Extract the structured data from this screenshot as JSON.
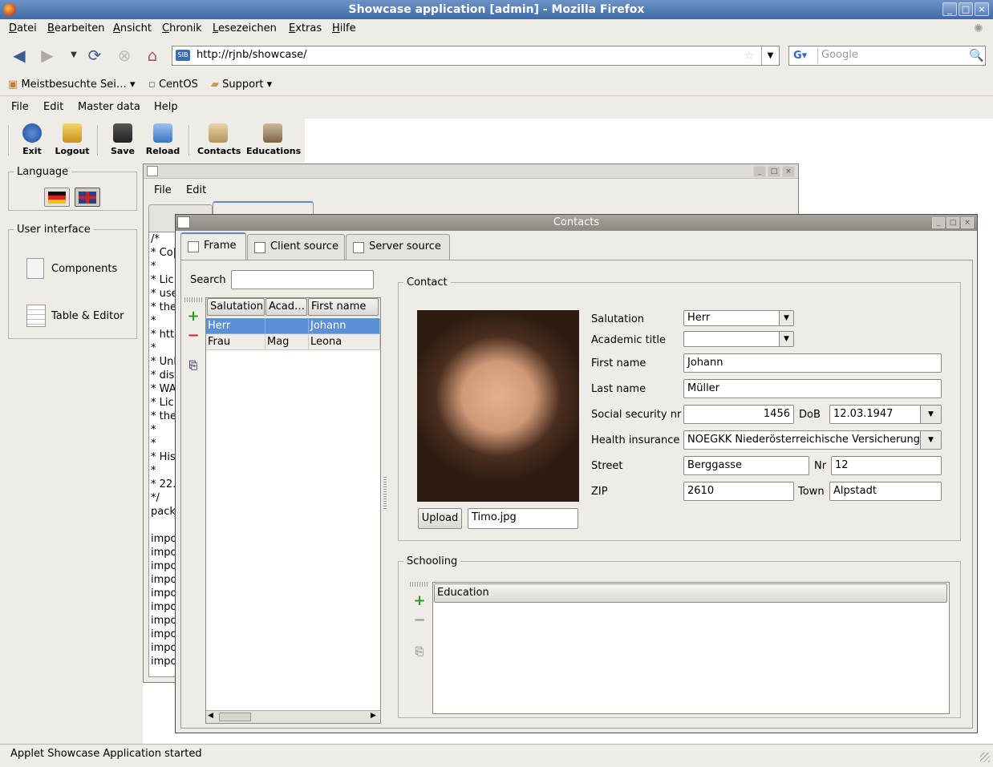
{
  "window": {
    "title": "Showcase application [admin] - Mozilla Firefox"
  },
  "browser_menu": [
    "Datei",
    "Bearbeiten",
    "Ansicht",
    "Chronik",
    "Lesezeichen",
    "Extras",
    "Hilfe"
  ],
  "nav": {
    "url": "http://rjnb/showcase/",
    "search_placeholder": "Google"
  },
  "bookmarks": [
    "Meistbesuchte Sei…",
    "CentOS",
    "Support"
  ],
  "app_menu": [
    "File",
    "Edit",
    "Master data",
    "Help"
  ],
  "toolbar": {
    "exit": "Exit",
    "logout": "Logout",
    "save": "Save",
    "reload": "Reload",
    "contacts": "Contacts",
    "educations": "Educations"
  },
  "left_panel": {
    "language_title": "Language",
    "ui_title": "User interface",
    "components": "Components",
    "table_editor": "Table & Editor"
  },
  "bg_frame": {
    "menu": [
      "File",
      "Edit"
    ],
    "code_lines": [
      "/*",
      "* Co|",
      "*",
      "* Lic",
      "* use",
      "* the",
      "*",
      "* http",
      "*",
      "* Unl",
      "* dist",
      "* WA",
      "* Lic",
      "* the",
      "*",
      "*",
      "* His",
      "*",
      "* 22.",
      "*/",
      "packa",
      "",
      "impo",
      "impo",
      "impo",
      "impo",
      "impo",
      "impo",
      "impo",
      "impo",
      "impo",
      "impo"
    ]
  },
  "contacts": {
    "title": "Contacts",
    "tabs": [
      "Frame",
      "Client source",
      "Server source"
    ],
    "search_label": "Search",
    "search_value": "",
    "table_headers": [
      "Salutation",
      "Acad…",
      "First name"
    ],
    "rows": [
      [
        "Herr",
        "",
        "Johann"
      ],
      [
        "Frau",
        "Mag",
        "Leona"
      ]
    ],
    "contact_group": "Contact",
    "upload_button": "Upload",
    "photo_file": "Timo.jpg",
    "fields": {
      "salutation_label": "Salutation",
      "salutation": "Herr",
      "academic_label": "Academic title",
      "academic": "",
      "first_name_label": "First name",
      "first_name": "Johann",
      "last_name_label": "Last name",
      "last_name": "Müller",
      "ssn_label": "Social security nr",
      "ssn": "1456",
      "dob_label": "DoB",
      "dob": "12.03.1947",
      "health_label": "Health insurance",
      "health": "NOEGKK Niederösterreichische Versicherung",
      "street_label": "Street",
      "street": "Berggasse",
      "nr_label": "Nr",
      "nr": "12",
      "zip_label": "ZIP",
      "zip": "2610",
      "town_label": "Town",
      "town": "Alpstadt"
    },
    "schooling_group": "Schooling",
    "education_header": "Education"
  },
  "status": "Applet Showcase Application started"
}
